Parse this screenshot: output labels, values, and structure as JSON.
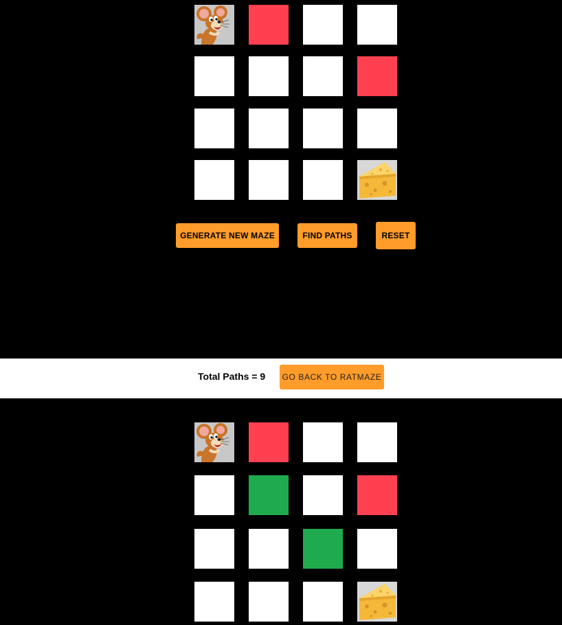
{
  "maze_before": {
    "rows": [
      [
        "rat",
        "blocked",
        "open",
        "open"
      ],
      [
        "open",
        "open",
        "open",
        "blocked"
      ],
      [
        "open",
        "open",
        "open",
        "open"
      ],
      [
        "open",
        "open",
        "open",
        "cheese"
      ]
    ]
  },
  "controls": {
    "generate_label": "GENERATE NEW MAZE",
    "find_label": "FIND PATHS",
    "reset_label": "RESET"
  },
  "summary": {
    "total_paths_text": "Total Paths = 9",
    "back_label": "GO BACK TO RATMAZE"
  },
  "maze_after": {
    "rows": [
      [
        "rat",
        "blocked",
        "open",
        "open"
      ],
      [
        "open",
        "path",
        "open",
        "blocked"
      ],
      [
        "open",
        "open",
        "path",
        "open"
      ],
      [
        "open",
        "open",
        "open",
        "cheese"
      ]
    ]
  },
  "colors": {
    "blocked": "#ff4050",
    "path": "#1faa4e",
    "open": "#ffffff",
    "button": "#ff9c2a"
  },
  "icons": {
    "start": "jerry-mouse-icon",
    "goal": "cheese-icon"
  }
}
